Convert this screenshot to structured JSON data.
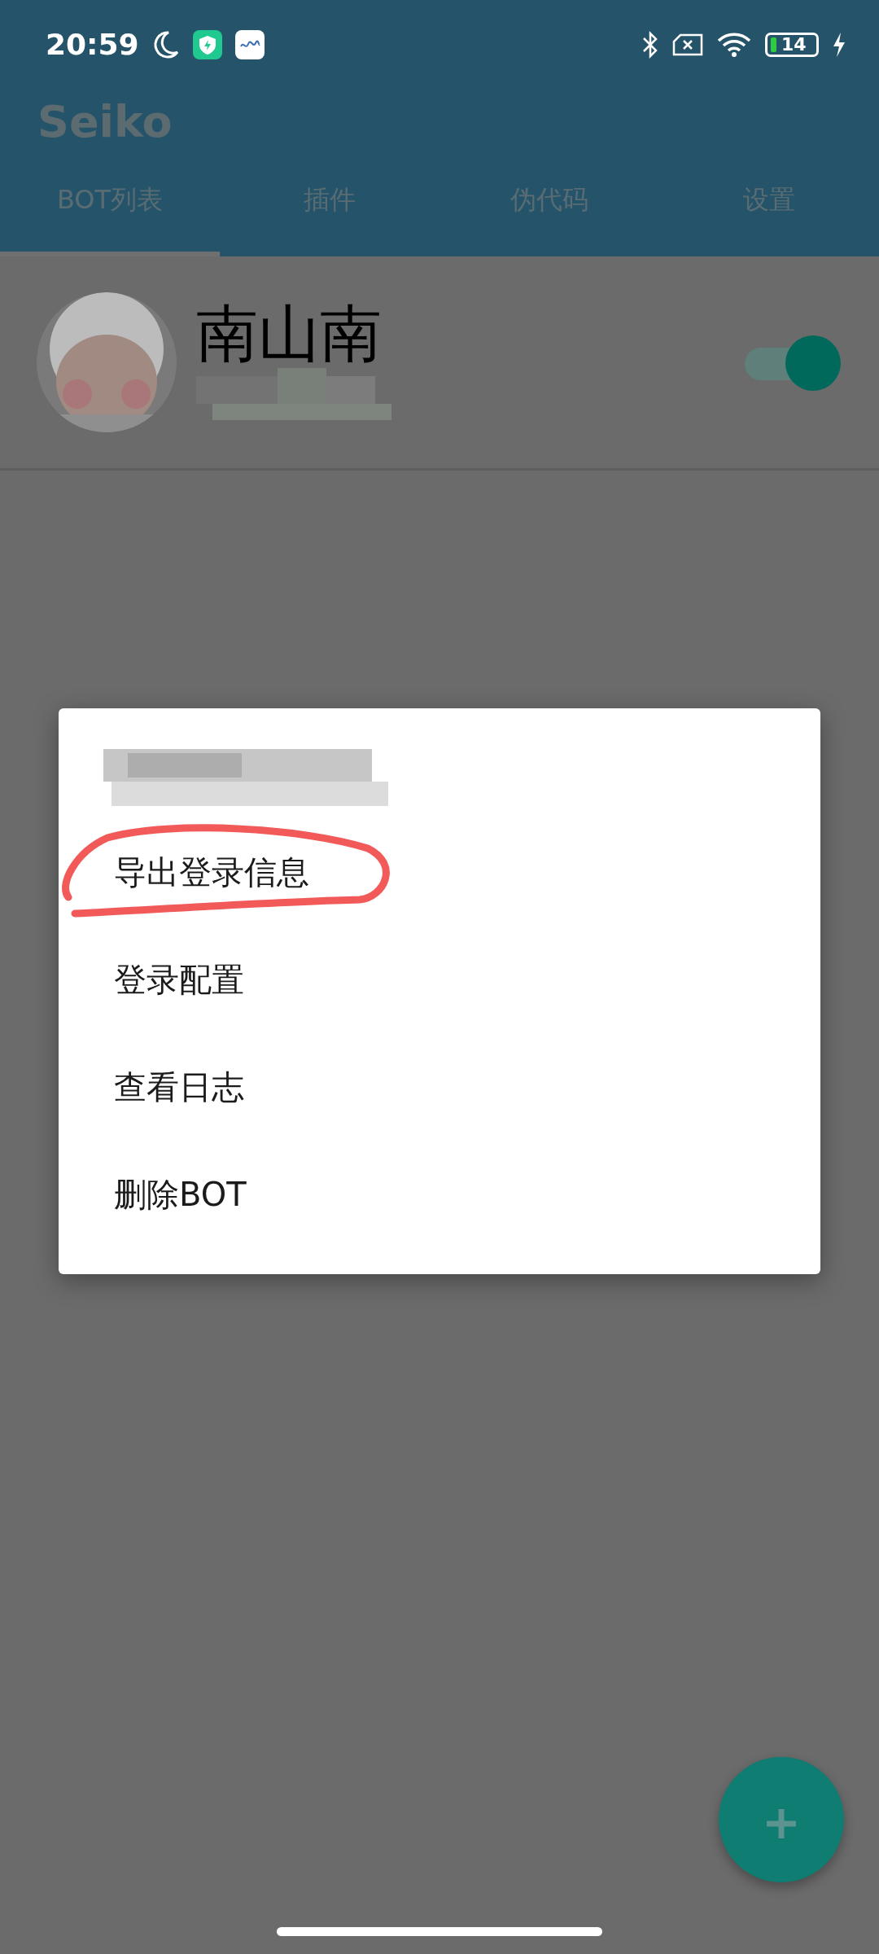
{
  "status_bar": {
    "time": "20:59",
    "battery": "14",
    "charging": true
  },
  "app_bar": {
    "title": "Seiko"
  },
  "tabs": [
    {
      "label": "BOT列表",
      "selected": true
    },
    {
      "label": "插件",
      "selected": false
    },
    {
      "label": "伪代码",
      "selected": false
    },
    {
      "label": "设置",
      "selected": false
    }
  ],
  "bots": [
    {
      "name": "南山南",
      "on": true
    }
  ],
  "dialog": {
    "items": [
      {
        "label": "导出登录信息",
        "circled": true
      },
      {
        "label": "登录配置",
        "circled": false
      },
      {
        "label": "查看日志",
        "circled": false
      },
      {
        "label": "删除BOT",
        "circled": false
      }
    ]
  }
}
